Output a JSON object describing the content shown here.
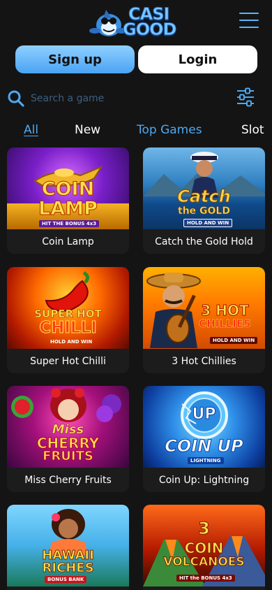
{
  "header": {
    "logo_line1": "CASI",
    "logo_line2": "GOOD",
    "menu_icon": "hamburger-menu-icon"
  },
  "auth": {
    "signup_label": "Sign up",
    "login_label": "Login"
  },
  "search": {
    "placeholder": "Search a game",
    "icon": "search-icon",
    "filter_icon": "filter-sliders-icon"
  },
  "tabs": [
    {
      "label": "All",
      "active": true
    },
    {
      "label": "New",
      "active": false
    },
    {
      "label": "Top Games",
      "active": false
    },
    {
      "label": "Slot",
      "active": false
    }
  ],
  "games": [
    {
      "name": "Coin Lamp",
      "art_title": [
        "COIN",
        "LAMP"
      ],
      "art_badge": "HIT THE BONUS 4x3"
    },
    {
      "name": "Catch the Gold Hold",
      "art_title": [
        "Catch",
        "the GOLD"
      ],
      "art_badge": "HOLD AND WIN"
    },
    {
      "name": "Super Hot Chilli",
      "art_title": [
        "SUPER HOT",
        "CHILLI"
      ],
      "art_badge": "HOLD AND WIN"
    },
    {
      "name": "3 Hot Chillies",
      "art_title": [
        "3 HOT",
        "CHILLIES"
      ],
      "art_badge": "HOLD AND WIN"
    },
    {
      "name": "Miss Cherry Fruits",
      "art_title": [
        "Miss",
        "CHERRY",
        "FRUITS"
      ],
      "art_badge": ""
    },
    {
      "name": "Coin Up: Lightning",
      "art_title": [
        "UP",
        "COIN UP"
      ],
      "art_badge": "LIGHTNING"
    },
    {
      "name": "",
      "art_title": [
        "HAWAII",
        "RICHES"
      ],
      "art_badge": "BONUS BANK"
    },
    {
      "name": "",
      "art_title": [
        "3",
        "COIN",
        "VOLCANOES"
      ],
      "art_badge": "HIT the BONUS 4x3"
    }
  ],
  "colors": {
    "background": "#141414",
    "accent": "#4da9f2",
    "signup_gradient_top": "#8fd0ff",
    "signup_gradient_bottom": "#4aa3f4"
  }
}
